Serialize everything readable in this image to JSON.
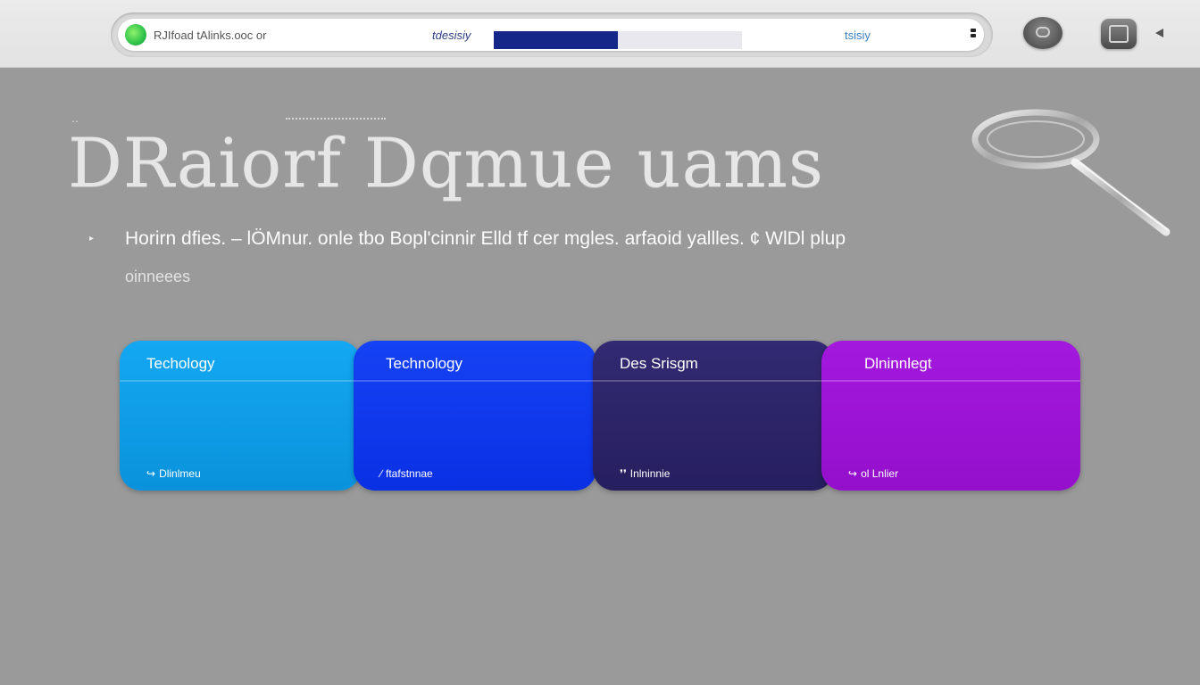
{
  "colors": {
    "background": "#9a9a9a",
    "topbar": "#e6e6e6",
    "progress_fill": "#15288a",
    "card_1": "#0b9ce8",
    "card_2": "#0a36ee",
    "card_3": "#2b2466",
    "card_4": "#9a0fd6"
  },
  "toolbar": {
    "site_icon": "globe-icon",
    "address_text": "RJIfoad tAlinks.ooc or",
    "address_mid": "tdesisiy",
    "address_right": "tsisiy",
    "load_progress": 0.5,
    "menu_icon": "kebab-menu-icon",
    "round_button_icon": "toggle-icon",
    "square_button_icon": "window-icon",
    "back_icon": "back-arrow-icon"
  },
  "hero": {
    "headline": "DRaiorf  Dqmue  uams",
    "magnifier_icon": "magnifier-icon"
  },
  "bullets": [
    {
      "text": "Horirn dfies. – lÖMnur. onle tbo Bopl'cinnir Elld tf cer mgles. arfaoid yallles. ¢ WlDl plup",
      "continuation": "oinneees"
    }
  ],
  "cards": [
    {
      "title": "Techology",
      "footer_icon": "link-icon",
      "footer_glyph": "↪",
      "footer": "Dlinlmeu"
    },
    {
      "title": "Technology",
      "footer_icon": "pen-icon",
      "footer_glyph": "∕",
      "footer": "ftafstnnae"
    },
    {
      "title": "Des Srisgm",
      "footer_icon": "quote-icon",
      "footer_glyph": "❜❜",
      "footer": "Inlninnie"
    },
    {
      "title": "Dlninnlegt",
      "footer_icon": "link-icon",
      "footer_glyph": "↪",
      "footer": "ol Lnlier"
    }
  ]
}
